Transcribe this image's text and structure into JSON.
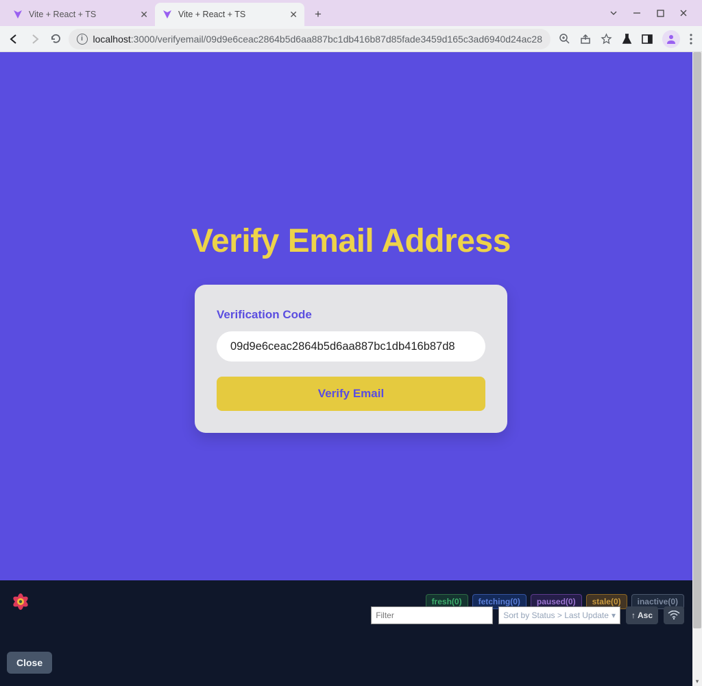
{
  "window": {
    "tabs": [
      {
        "title": "Vite + React + TS",
        "active": false
      },
      {
        "title": "Vite + React + TS",
        "active": true
      }
    ]
  },
  "url": {
    "host": "localhost",
    "port": ":3000",
    "path": "/verifyemail/09d9e6ceac2864b5d6aa887bc1db416b87d85fade3459d165c3ad6940d24ac28"
  },
  "page": {
    "title": "Verify Email Address",
    "field_label": "Verification Code",
    "code_value": "09d9e6ceac2864b5d6aa887bc1db416b87d8",
    "button_label": "Verify Email"
  },
  "devtools": {
    "statuses": {
      "fresh": "fresh(0)",
      "fetching": "fetching(0)",
      "paused": "paused(0)",
      "stale": "stale(0)",
      "inactive": "inactive(0)"
    },
    "filter_placeholder": "Filter",
    "sort_label": "Sort by Status > Last Update",
    "order_label": "Asc",
    "close_label": "Close"
  }
}
